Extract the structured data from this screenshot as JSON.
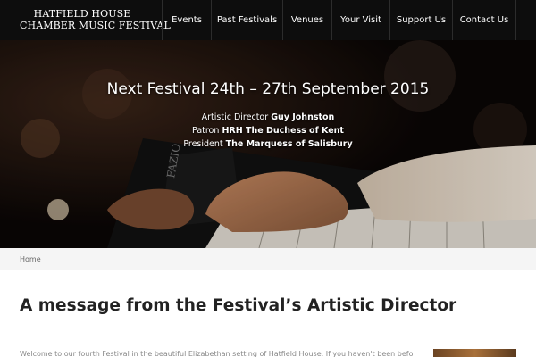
{
  "header": {
    "logo_line1": "HATFIELD HOUSE",
    "logo_line2": "CHAMBER MUSIC FESTIVAL",
    "nav": [
      {
        "label": "Events"
      },
      {
        "label": "Past Festivals"
      },
      {
        "label": "Venues"
      },
      {
        "label": "Your Visit"
      },
      {
        "label": "Support Us"
      },
      {
        "label": "Contact Us"
      }
    ]
  },
  "hero": {
    "title": "Next Festival 24th – 27th September 2015",
    "credits": [
      {
        "role": "Artistic Director",
        "name": "Guy Johnston"
      },
      {
        "role": "Patron",
        "name": "HRH The Duchess of Kent"
      },
      {
        "role": "President",
        "name": "The Marquess of Salisbury"
      }
    ]
  },
  "breadcrumb": {
    "home": "Home"
  },
  "main": {
    "title_prefix": "A message from the Festival’s",
    "title_bold": "Artistic Director",
    "intro": "Welcome to our fourth Festival in the beautiful Elizabethan setting of Hatfield House. If you haven't been before,"
  },
  "colors": {
    "header_bg": "#0d0d0d",
    "breadcrumb_bg": "#f5f5f5",
    "title_text": "#222222"
  }
}
